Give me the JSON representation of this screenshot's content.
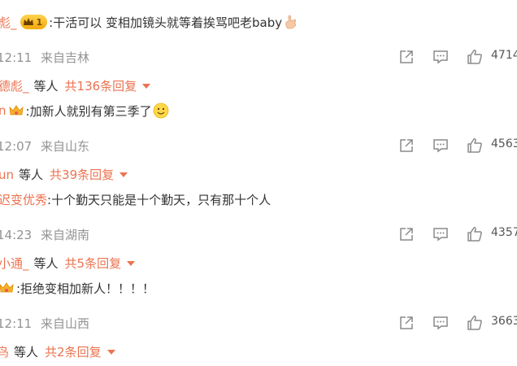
{
  "comments": [
    {
      "user": "彪_",
      "badge_text": "1",
      "text": ":干活可以 变相加镜头就等着挨骂吧老baby",
      "time": "12:11",
      "location": "来自吉林",
      "likes": "4714",
      "replier": "德彪_",
      "replier_suffix": "等人",
      "reply_count": "共136条回复"
    },
    {
      "user": "n",
      "text": ":加新人就别有第三季了",
      "time": "12:07",
      "location": "来自山东",
      "likes": "4563",
      "replier": "un",
      "replier_suffix": "等人",
      "reply_count": "共39条回复"
    },
    {
      "user": "迟变优秀",
      "text": ":十个勤天只能是十个勤天，只有那十个人",
      "time": "14:23",
      "location": "来自湖南",
      "likes": "4357",
      "replier": "小通_",
      "replier_suffix": "等人",
      "reply_count": "共5条回复"
    },
    {
      "user": "",
      "text": ":拒绝变相加新人！！！！",
      "time": "12:11",
      "location": "来自山西",
      "likes": "3663",
      "replier": "鸟",
      "replier_suffix": "等人",
      "reply_count": "共2条回复"
    }
  ],
  "icons": {
    "share": "share-icon",
    "comment": "comment-icon",
    "like": "like-icon",
    "expand": "chevron-down-icon"
  },
  "colors": {
    "accent": "#eb7350",
    "meta": "#939393"
  }
}
